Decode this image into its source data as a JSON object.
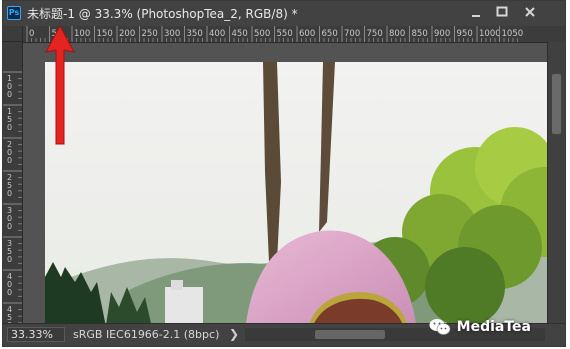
{
  "window": {
    "title": "未标题-1 @ 33.3% (PhotoshopTea_2, RGB/8) *",
    "app_icon_text": "Ps"
  },
  "ruler": {
    "top_ticks": [
      "0",
      "50",
      "100",
      "150",
      "200",
      "250",
      "300",
      "350",
      "400",
      "450",
      "500",
      "550",
      "600",
      "650",
      "700",
      "750",
      "800",
      "850",
      "900",
      "950",
      "1000",
      "1050"
    ],
    "left_ticks": [
      "1\n0\n0",
      "1\n5\n0",
      "2\n0\n0",
      "2\n5\n0",
      "3\n0\n0",
      "3\n5\n0",
      "4\n0\n0",
      "4\n5\n0"
    ]
  },
  "status": {
    "zoom": "33.33%",
    "doc_info": "sRGB IEC61966-2.1 (8bpc)",
    "more_arrow": "❯"
  },
  "watermark": {
    "text": "MediaTea"
  },
  "colors": {
    "panel": "#535353",
    "titlebar": "#424242",
    "annotation_arrow": "#e52421"
  }
}
